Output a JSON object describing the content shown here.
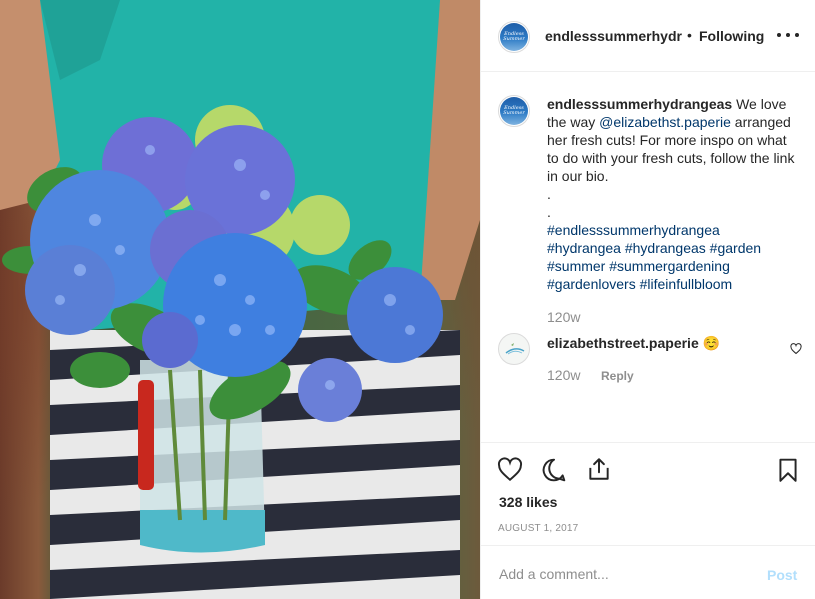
{
  "post": {
    "image_alt": "Bouquet of blue hydrangeas in a glass jar",
    "header": {
      "username": "endlesssummerhydr",
      "separator": "•",
      "follow_status": "Following",
      "avatar_text": "Endless Summer"
    },
    "caption": {
      "username": "endlesssummerhydrangeas",
      "text_before": " We love the way ",
      "mention": "@elizabethst.paperie",
      "text_after": " arranged her fresh cuts! For more inspo on what to do with your fresh cuts, follow the link in our bio.",
      "dot1": ".",
      "dot2": ".",
      "hashtags_line1": "#endlesssummerhydrangea",
      "hashtags_line2": "#hydrangea #hydrangeas #garden",
      "hashtags_line3": "#summer #summergardening",
      "hashtags_line4": "#gardenlovers #lifeinfullbloom",
      "time": "120w"
    },
    "comment": {
      "username": "elizabethstreet.paperie",
      "emoji": "☺️",
      "time": "120w",
      "reply_label": "Reply"
    },
    "actions": {
      "likes": "328 likes",
      "date": "AUGUST 1, 2017"
    },
    "comment_box": {
      "placeholder": "Add a comment...",
      "post_label": "Post"
    }
  },
  "icons": {
    "like": "heart-icon",
    "comment": "comment-bubble-icon",
    "share": "share-icon",
    "save": "bookmark-icon",
    "more": "more-options-icon",
    "comment_like": "small-heart-icon"
  },
  "colors": {
    "text": "#262626",
    "muted": "#8e8e8e",
    "link": "#00376b",
    "post_disabled": "#b2dffc",
    "divider": "#efefef"
  }
}
